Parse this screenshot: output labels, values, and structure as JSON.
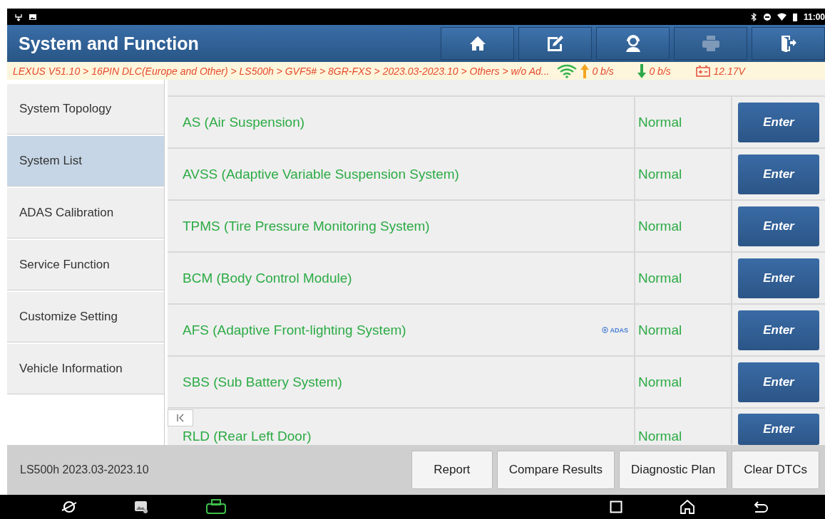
{
  "status_bar": {
    "time": "11:00"
  },
  "header": {
    "title": "System and Function",
    "tools": [
      {
        "kind": "home",
        "disabled": false
      },
      {
        "kind": "edit",
        "disabled": false
      },
      {
        "kind": "support",
        "disabled": false
      },
      {
        "kind": "print",
        "disabled": true
      },
      {
        "kind": "exit",
        "disabled": false
      }
    ]
  },
  "breadcrumb": {
    "path": "LEXUS V51.10 > 16PIN DLC(Europe and Other) > LS500h > GVF5# > 8GR-FXS > 2023.03-2023.10 > Others > w/o Ad...",
    "upload": "0 b/s",
    "download": "0 b/s",
    "voltage": "12.17V"
  },
  "sidebar": {
    "items": [
      {
        "label": "System Topology",
        "selected": false
      },
      {
        "label": "System List",
        "selected": true
      },
      {
        "label": "ADAS Calibration",
        "selected": false
      },
      {
        "label": "Service Function",
        "selected": false
      },
      {
        "label": "Customize Setting",
        "selected": false
      },
      {
        "label": "Vehicle Information",
        "selected": false
      }
    ]
  },
  "systems": [
    {
      "name": "AS (Air Suspension)",
      "status": "Normal",
      "adas": false,
      "button": "Enter"
    },
    {
      "name": "AVSS (Adaptive Variable Suspension System)",
      "status": "Normal",
      "adas": false,
      "button": "Enter"
    },
    {
      "name": "TPMS (Tire Pressure Monitoring System)",
      "status": "Normal",
      "adas": false,
      "button": "Enter"
    },
    {
      "name": "BCM (Body Control Module)",
      "status": "Normal",
      "adas": false,
      "button": "Enter"
    },
    {
      "name": "AFS (Adaptive Front-lighting System)",
      "status": "Normal",
      "adas": true,
      "adas_label": "ADAS",
      "button": "Enter"
    },
    {
      "name": "SBS (Sub Battery System)",
      "status": "Normal",
      "adas": false,
      "button": "Enter"
    },
    {
      "name": "RLD (Rear Left Door)",
      "status": "Normal",
      "adas": false,
      "button": "Enter"
    }
  ],
  "footer": {
    "vehicle": "LS500h 2023.03-2023.10",
    "buttons": [
      "Report",
      "Compare Results",
      "Diagnostic Plan",
      "Clear DTCs"
    ]
  }
}
